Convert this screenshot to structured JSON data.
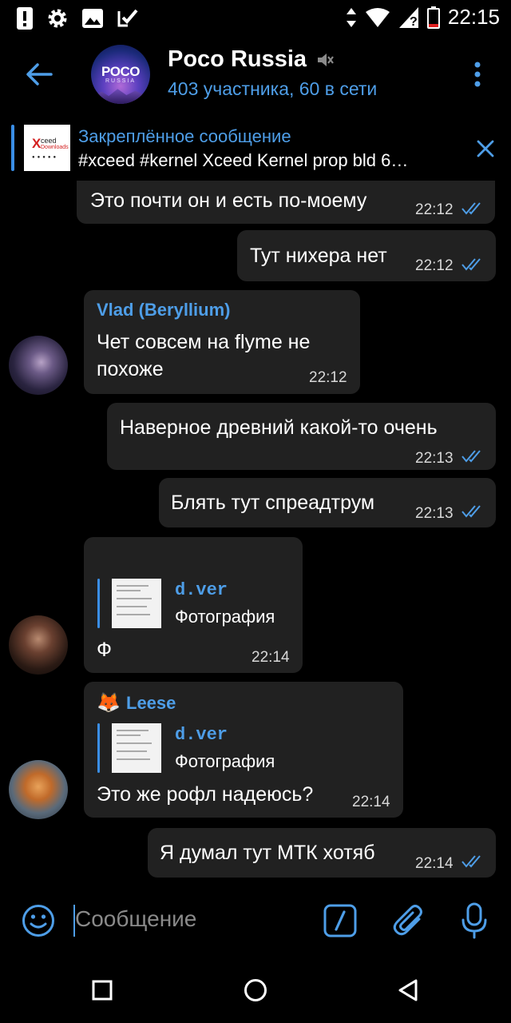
{
  "status_bar": {
    "time": "22:15"
  },
  "header": {
    "title": "Poco Russia",
    "subtitle": "403 участника, 60 в сети",
    "avatar_line1": "POCO",
    "avatar_line2": "RUSSIA"
  },
  "pinned": {
    "title": "Закреплённое сообщение",
    "text": "#xceed #kernel Xceed Kernel prop bld 6…",
    "thumb_logo": "X",
    "thumb_logo2": "ceed",
    "thumb_logo3": "Downloads"
  },
  "messages": [
    {
      "id": "m1",
      "text": "Это почти он и есть по-моему",
      "time": "22:12"
    },
    {
      "id": "m2",
      "text": "Тут нихера нет",
      "time": "22:12"
    },
    {
      "id": "m3",
      "sender": "Vlad (Beryllium)",
      "text_line1": "Чет совсем на flyme не",
      "text_line2": "похоже",
      "time": "22:12"
    },
    {
      "id": "m4",
      "text": "Наверное древний какой-то очень",
      "time": "22:13"
    },
    {
      "id": "m5",
      "text": "Блять тут спреадтрум",
      "time": "22:13"
    },
    {
      "id": "m6",
      "reply_name": "d.ver",
      "reply_text": "Фотография",
      "text": "Ф",
      "time": "22:14"
    },
    {
      "id": "m7",
      "sender_emoji": "🦊",
      "sender": "Leese",
      "reply_name": "d.ver",
      "reply_text": "Фотография",
      "text": "Это же рофл надеюсь?",
      "time": "22:14"
    },
    {
      "id": "m8",
      "text": "Я думал тут МТК хотяб",
      "time": "22:14"
    }
  ],
  "input": {
    "placeholder": "Сообщение"
  },
  "colors": {
    "accent": "#4e9ee8",
    "bubble": "#212121",
    "background": "#000000"
  }
}
